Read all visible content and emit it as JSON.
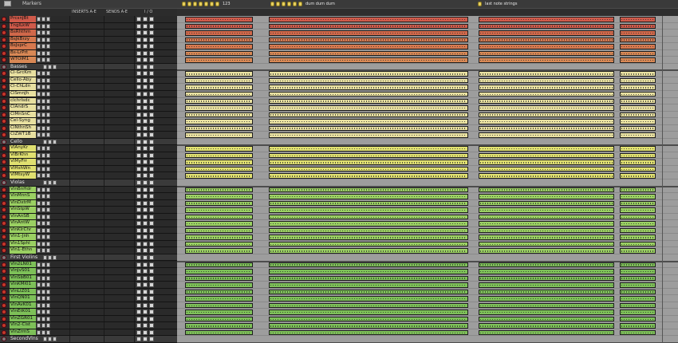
{
  "header": {
    "markers_label": "Markers",
    "col_inserts": "INSERTS A-E",
    "col_sends": "SENDS A-E",
    "col_io": "I / O"
  },
  "markers": [
    {
      "label": "123"
    },
    {
      "label": "dum dum dum"
    },
    {
      "label": "last note strings"
    }
  ],
  "tracks": [
    {
      "name": "PrcsnJBt",
      "folder": false,
      "color": "#d05a4a"
    },
    {
      "name": "TnglLkW",
      "folder": false,
      "color": "#d05a4a"
    },
    {
      "name": "BsRhthm",
      "folder": false,
      "color": "#d0684a"
    },
    {
      "name": "BsJkBrzy",
      "folder": false,
      "color": "#d6784e"
    },
    {
      "name": "BsJsprC",
      "folder": false,
      "color": "#d6784e"
    },
    {
      "name": "Bs-LrPrt",
      "folder": false,
      "color": "#d88855"
    },
    {
      "name": "WTOlM1",
      "folder": false,
      "color": "#d88855"
    },
    {
      "name": "Basses",
      "folder": true,
      "color": "#d8d080"
    },
    {
      "name": "Cl-GrcKm",
      "folder": false,
      "color": "#e8e0a0"
    },
    {
      "name": "Cello-Aby",
      "folder": false,
      "color": "#e8e0a0"
    },
    {
      "name": "Cl-ChLdn",
      "folder": false,
      "color": "#e8e0a0"
    },
    {
      "name": "ClSmnJh",
      "folder": false,
      "color": "#e8e0a0"
    },
    {
      "name": "clchrlsdc",
      "folder": false,
      "color": "#e8e0a0"
    },
    {
      "name": "ClAndrS",
      "folder": false,
      "color": "#e8e0a0"
    },
    {
      "name": "ClMnSnC",
      "folder": false,
      "color": "#e8e0a0"
    },
    {
      "name": "Cel-Syng",
      "folder": false,
      "color": "#e8e0a0"
    },
    {
      "name": "ClNthnSh",
      "folder": false,
      "color": "#e8e0a0"
    },
    {
      "name": "ClZWT1B",
      "folder": false,
      "color": "#e8e0a0"
    },
    {
      "name": "Cello",
      "folder": true,
      "color": "#d8d070"
    },
    {
      "name": "VlAnyKr",
      "folder": false,
      "color": "#e0e070"
    },
    {
      "name": "VlBrKhn",
      "folder": false,
      "color": "#e0e070"
    },
    {
      "name": "VlMyFrr",
      "folder": false,
      "color": "#e0e070"
    },
    {
      "name": "VlHshWn",
      "folder": false,
      "color": "#e0e070"
    },
    {
      "name": "VlMtsyW",
      "folder": false,
      "color": "#e0e070"
    },
    {
      "name": "Violas",
      "folder": true,
      "color": "#a8d070"
    },
    {
      "name": "VlnBnHdr",
      "folder": false,
      "color": "#9ad062"
    },
    {
      "name": "VlnMnnS",
      "folder": false,
      "color": "#9ad062"
    },
    {
      "name": "VlnDxtrM",
      "folder": false,
      "color": "#9ad062"
    },
    {
      "name": "VlnStpW",
      "folder": false,
      "color": "#9ad062"
    },
    {
      "name": "VlnAnSB",
      "folder": false,
      "color": "#9ad062"
    },
    {
      "name": "VlnAntW",
      "folder": false,
      "color": "#9ad062"
    },
    {
      "name": "VlnKlrChr",
      "folder": false,
      "color": "#9ad062"
    },
    {
      "name": "Vln1-Jnh",
      "folder": false,
      "color": "#9ad062"
    },
    {
      "name": "Vln1Sphl",
      "folder": false,
      "color": "#9ad062"
    },
    {
      "name": "Vln1-Ethn",
      "folder": false,
      "color": "#9ad062"
    },
    {
      "name": "First Violins",
      "folder": true,
      "color": "#90c060"
    },
    {
      "name": "Vln2LN01",
      "folder": false,
      "color": "#7dc058"
    },
    {
      "name": "VlnJvS01",
      "folder": false,
      "color": "#7dc058"
    },
    {
      "name": "VlnSbB01",
      "folder": false,
      "color": "#7dc058"
    },
    {
      "name": "VlnKMl01",
      "folder": false,
      "color": "#7dc058"
    },
    {
      "name": "VlnLlZ01",
      "folder": false,
      "color": "#7dc058"
    },
    {
      "name": "VlnQN01",
      "folder": false,
      "color": "#7dc058"
    },
    {
      "name": "VlnAvK01",
      "folder": false,
      "color": "#7dc058"
    },
    {
      "name": "VlnEtK01",
      "folder": false,
      "color": "#7dc058"
    },
    {
      "name": "VlnZGR01",
      "folder": false,
      "color": "#7dc058"
    },
    {
      "name": "Vln2-Clst",
      "folder": false,
      "color": "#7dc058"
    },
    {
      "name": "VlnZrmS",
      "folder": false,
      "color": "#7dc058"
    },
    {
      "name": "SecondVlns",
      "folder": true,
      "color": "#70b050"
    }
  ]
}
